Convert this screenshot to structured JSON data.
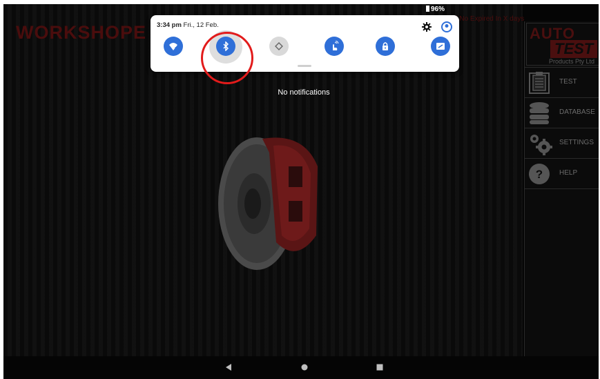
{
  "status_bar": {
    "battery": "96%"
  },
  "app": {
    "title": "WORKSHOPE",
    "header_note": "Serial No Expired In X days",
    "center_message": "No notifications",
    "brand": {
      "line1": "AUTO",
      "line2": "TEST",
      "line3": "Products Pty Ltd"
    },
    "menu": [
      {
        "label": "TEST",
        "icon": "clipboard-icon"
      },
      {
        "label": "DATABASE",
        "icon": "database-icon"
      },
      {
        "label": "SETTINGS",
        "icon": "gears-icon"
      },
      {
        "label": "HELP",
        "icon": "help-icon"
      }
    ]
  },
  "shade": {
    "time": "3:34 pm",
    "date": "Fri., 12 Feb.",
    "tiles": [
      {
        "name": "wifi",
        "icon": "wifi-icon",
        "state": "on"
      },
      {
        "name": "bluetooth",
        "icon": "bluetooth-icon",
        "state": "on"
      },
      {
        "name": "auto-rotate",
        "icon": "rotate-icon",
        "state": "off"
      },
      {
        "name": "touch",
        "icon": "touch-icon",
        "state": "on"
      },
      {
        "name": "lock",
        "icon": "lock-icon",
        "state": "on"
      },
      {
        "name": "screen-cast",
        "icon": "cast-icon",
        "state": "on"
      }
    ],
    "colors": {
      "tile_on": "#2f6fd8",
      "tile_off": "#d9d9d9",
      "highlight": "#e21b1b"
    }
  },
  "nav": {
    "back": "back-icon",
    "home": "home-icon",
    "recents": "recents-icon"
  }
}
